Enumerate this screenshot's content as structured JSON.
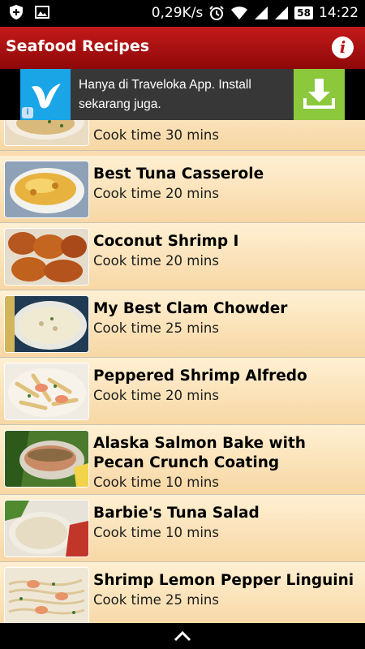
{
  "status_bar": {
    "speed": "0,29K/s",
    "battery": "58",
    "time": "14:22",
    "icons": [
      "shield-plus-icon",
      "image-icon",
      "alarm-clock-icon",
      "wifi-icon",
      "signal-icon",
      "signal-icon",
      "battery-icon"
    ]
  },
  "app": {
    "title": "Seafood Recipes",
    "info_icon": "i"
  },
  "ad": {
    "text": "Hanya di Traveloka App. Install sekarang juga.",
    "badge": "i"
  },
  "recipes": [
    {
      "title": "",
      "cook_time": "Cook time 30 mins"
    },
    {
      "title": "Best Tuna Casserole",
      "cook_time": "Cook time 20 mins"
    },
    {
      "title": "Coconut Shrimp I",
      "cook_time": "Cook time 20 mins"
    },
    {
      "title": "My Best Clam Chowder",
      "cook_time": "Cook time 25 mins"
    },
    {
      "title": "Peppered Shrimp Alfredo",
      "cook_time": "Cook time 20 mins"
    },
    {
      "title": "Alaska Salmon Bake with Pecan Crunch Coating",
      "cook_time": "Cook time 10 mins"
    },
    {
      "title": "Barbie's Tuna Salad",
      "cook_time": "Cook time 10 mins"
    },
    {
      "title": "Shrimp Lemon Pepper Linguini",
      "cook_time": "Cook time 25 mins"
    }
  ],
  "colors": {
    "app_bar": "#b81212",
    "list_bg": "#f9ddb0",
    "ad_cta": "#8bc83c",
    "ad_logo": "#1aa5e6"
  }
}
